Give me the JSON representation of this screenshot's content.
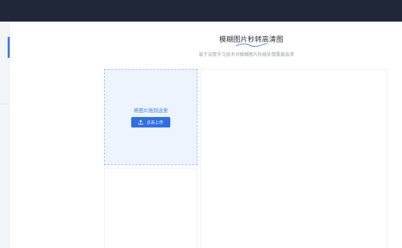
{
  "page": {
    "title": "模糊图片秒转高清图",
    "subtitle": "基于深度学习技术对模糊图片秒级处理重建高清"
  },
  "upload": {
    "drop_hint": "将图片拖到这里",
    "button_label": "点击上传"
  },
  "colors": {
    "topbar": "#1f2838",
    "accent": "#3b7cf4",
    "button": "#2f6fe6",
    "upload_bg": "#eef4fe"
  },
  "icons": {
    "upload": "upload-icon",
    "title_underline": "wave-underline-icon"
  }
}
